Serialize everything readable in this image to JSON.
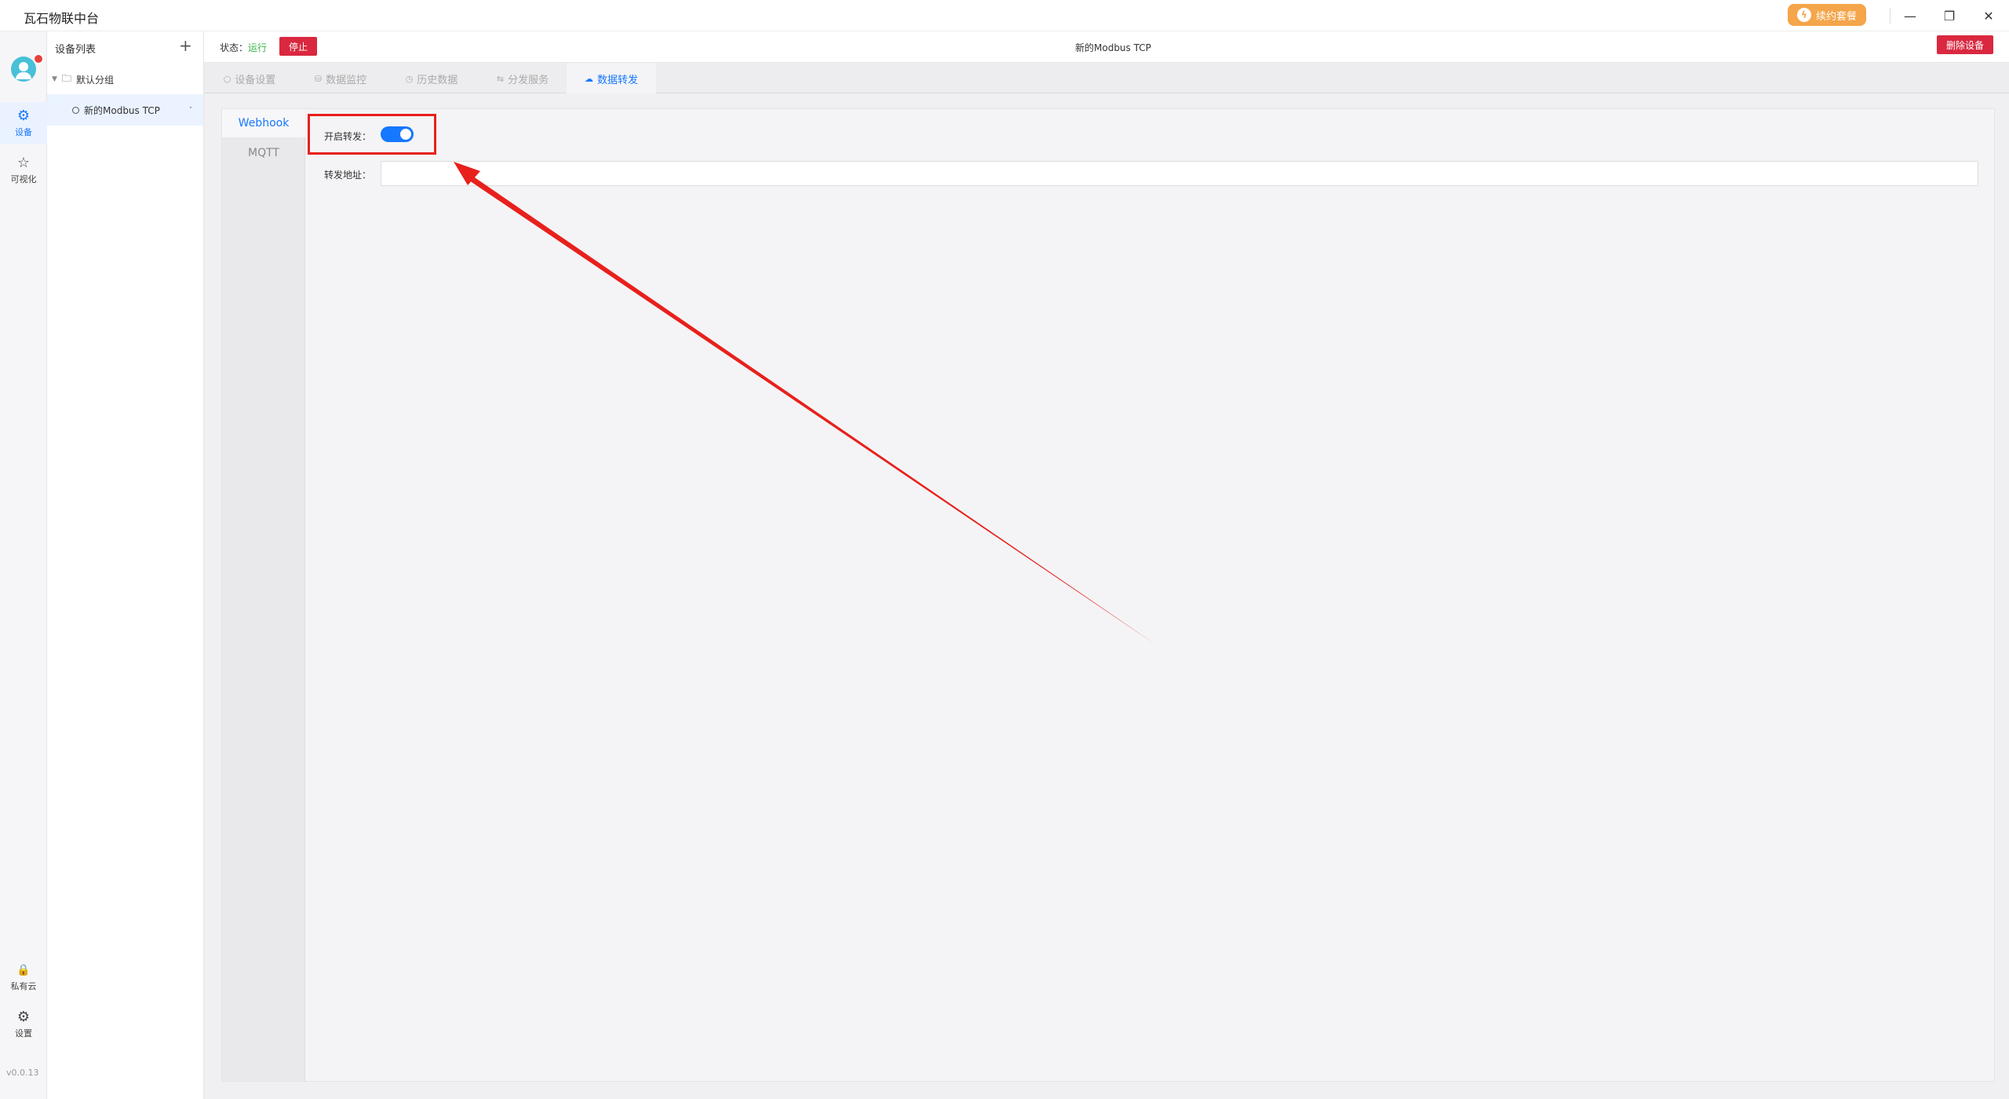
{
  "app": {
    "title": "瓦石物联中台",
    "renew_label": "续约套餐",
    "window_controls": {
      "minimize": "—",
      "restore": "❐",
      "close": "✕"
    }
  },
  "rail": {
    "items": [
      {
        "label": "设备",
        "icon": "chip-icon",
        "glyph": "⚙"
      },
      {
        "label": "可视化",
        "icon": "star-icon",
        "glyph": "☆"
      },
      {
        "label": "私有云",
        "icon": "lock-icon",
        "glyph": "🔒"
      },
      {
        "label": "设置",
        "icon": "gear-icon",
        "glyph": "⚙"
      }
    ],
    "version": "v0.0.13"
  },
  "device_panel": {
    "header": "设备列表",
    "add": "+",
    "group": {
      "label": "默认分组"
    },
    "devices": [
      {
        "name": "新的Modbus TCP",
        "more": "·"
      }
    ]
  },
  "topbar": {
    "status_label": "状态：",
    "status_value": "运行",
    "stop_label": "停止",
    "device_title": "新的Modbus TCP",
    "delete_label": "删除设备"
  },
  "tabs": [
    {
      "label": "设备设置",
      "icon": "○"
    },
    {
      "label": "数据监控",
      "icon": "⛁"
    },
    {
      "label": "历史数据",
      "icon": "◷"
    },
    {
      "label": "分发服务",
      "icon": "⇆"
    },
    {
      "label": "数据转发",
      "icon": "☁"
    }
  ],
  "forward": {
    "subtabs": [
      "Webhook",
      "MQTT"
    ],
    "enable_label": "开启转发：",
    "enable_on": true,
    "address_label": "转发地址：",
    "address_value": ""
  },
  "colors": {
    "accent": "#1677ff",
    "danger": "#d9283f",
    "running": "#3ab54a",
    "annotation": "#e8201c",
    "renew": "#f5a54a"
  }
}
